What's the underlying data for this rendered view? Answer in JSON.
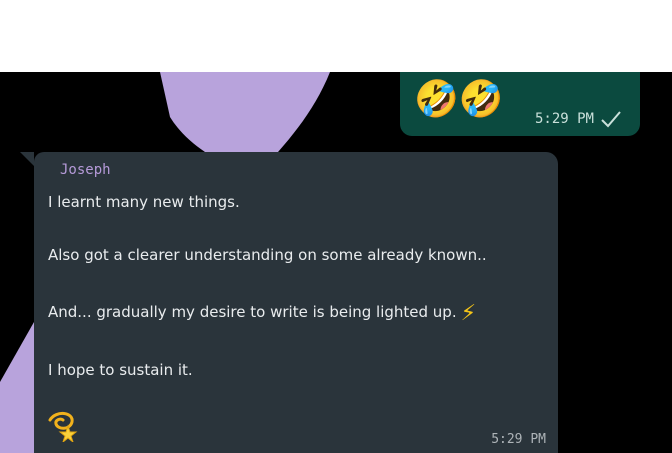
{
  "outgoing": {
    "emojis": "🤣🤣",
    "time": "5:29 PM",
    "status_icon": "check-icon"
  },
  "incoming": {
    "sender": "Joseph",
    "lines": [
      "I learnt many new things.",
      "Also got a clearer understanding on some already known..",
      "And... gradually my desire to write is being lighted up.",
      "I hope to sustain it."
    ],
    "bolt": "⚡",
    "sticker_icon": "dizzy-icon",
    "time": "5:29 PM"
  },
  "colors": {
    "outgoing_bubble": "#0b4a3f",
    "incoming_bubble": "#2a343b",
    "sender_name": "#b59ad8",
    "wallpaper_shape": "#b8a3dc"
  }
}
